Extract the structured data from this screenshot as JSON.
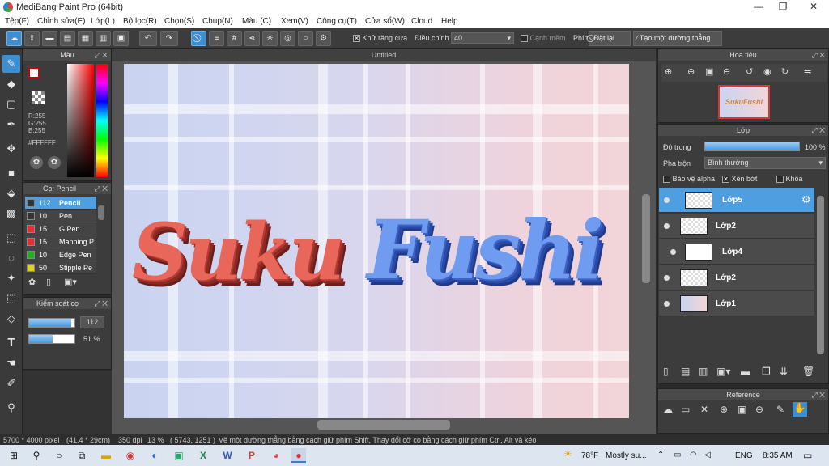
{
  "window": {
    "title": "MediBang Paint Pro (64bit)",
    "min": "—",
    "max": "❐",
    "close": "✕"
  },
  "menu": [
    "Tệp(F)",
    "Chỉnh sửa(E)",
    "Lớp(L)",
    "Bộ lọc(R)",
    "Chọn(S)",
    "Chụp(N)",
    "Màu (C)",
    "Xem(V)",
    "Công cụ(T)",
    "Cửa sổ(W)",
    "Cloud",
    "Help"
  ],
  "toolbar": {
    "antialias": "Khử răng cưa",
    "adjust_label": "Điều chỉnh",
    "adjust_value": "40",
    "edge": "Cạnh mềm",
    "key_label": "Phím",
    "reset": "Đặt lại",
    "straight": "Tạo một đường thẳng"
  },
  "color_panel": {
    "title": "Màu",
    "r": "R:255",
    "g": "G:255",
    "b": "B:255",
    "hex": "#FFFFFF"
  },
  "brush_panel": {
    "title": "Cọ: Pencil",
    "items": [
      {
        "size": "112",
        "name": "Pencil",
        "color": "#333333"
      },
      {
        "size": "10",
        "name": "Pen",
        "color": "#333333"
      },
      {
        "size": "15",
        "name": "G Pen",
        "color": "#e03030"
      },
      {
        "size": "15",
        "name": "Mapping P",
        "color": "#e03030"
      },
      {
        "size": "10",
        "name": "Edge Pen",
        "color": "#20b020"
      },
      {
        "size": "50",
        "name": "Stipple Pe",
        "color": "#e0d020"
      }
    ]
  },
  "brush_control": {
    "title": "Kiểm soát cọ",
    "size": "112",
    "opacity": "51 %",
    "size_fill": 0.92,
    "opacity_fill": 0.51
  },
  "document": {
    "tab": "Untitled",
    "lettering_left": "Suku",
    "lettering_right": "Fushi"
  },
  "navigator": {
    "title": "Hoa tiêu",
    "thumb_text": "SukuFushi"
  },
  "layer_panel": {
    "title": "Lớp",
    "opacity_label": "Độ trong",
    "opacity_value": "100 %",
    "blend_label": "Pha trộn",
    "blend_value": "Bình thường",
    "protect_alpha": "Bảo vệ alpha",
    "clipping": "Xén bớt",
    "lock": "Khóa",
    "layers": [
      {
        "name": "Lớp5",
        "selected": true
      },
      {
        "name": "Lớp2"
      },
      {
        "name": "Lớp4"
      },
      {
        "name": "Lớp2"
      },
      {
        "name": "Lớp1"
      }
    ]
  },
  "reference": {
    "title": "Reference"
  },
  "status": {
    "size": "5700 * 4000 pixel",
    "cm": "(41.4 * 29cm)",
    "dpi": "350 dpi",
    "zoom": "13 %",
    "coords": "( 5743, 1251 )",
    "hint": "Vẽ một đường thẳng bằng cách giữ phím Shift, Thay đổi cỡ cọ bằng cách giữ phím Ctrl, Alt và kéo"
  },
  "taskbar": {
    "weather": "78°F",
    "weather_text": "Mostly su...",
    "lang": "ENG",
    "time": "8:35 AM"
  }
}
